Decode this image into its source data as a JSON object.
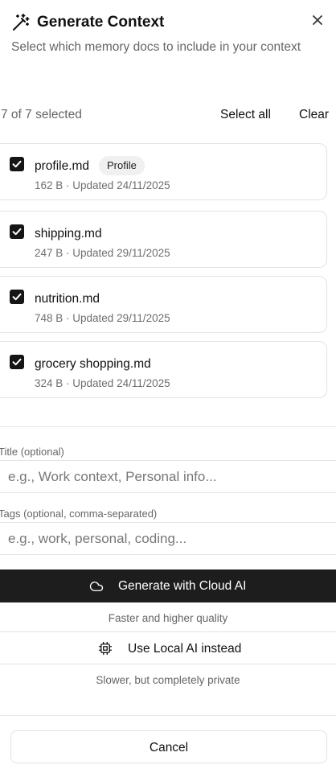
{
  "header": {
    "title": "Generate Context",
    "subtitle": "Select which memory docs to include in your context"
  },
  "selection": {
    "count_text": "7 of 7 selected",
    "select_all_label": "Select all",
    "clear_label": "Clear"
  },
  "docs": [
    {
      "name": "profile.md",
      "badge": "Profile",
      "meta": "162 B · Updated 24/11/2025",
      "checked": true
    },
    {
      "name": "shipping.md",
      "meta": "247 B · Updated 29/11/2025",
      "checked": true
    },
    {
      "name": "nutrition.md",
      "meta": "748 B · Updated 29/11/2025",
      "checked": true
    },
    {
      "name": "grocery shopping.md",
      "meta": "324 B · Updated 24/11/2025",
      "checked": true
    }
  ],
  "form": {
    "title_label": "Title (optional)",
    "title_value": "",
    "title_placeholder": "e.g., Work context, Personal info...",
    "tags_label": "Tags (optional, comma-separated)",
    "tags_value": "",
    "tags_placeholder": "e.g., work, personal, coding..."
  },
  "actions": {
    "cloud_label": "Generate with Cloud AI",
    "cloud_hint": "Faster and higher quality",
    "local_label": "Use Local AI instead",
    "local_hint": "Slower, but completely private",
    "cancel_label": "Cancel"
  },
  "icons": {
    "header": "magic-wand-icon",
    "close": "close-icon",
    "checkbox": "checkbox-checked-icon",
    "cloud": "cloud-icon",
    "local": "cpu-chip-icon"
  },
  "colors": {
    "primary_button": "#1d1d1d",
    "checkbox": "#151515",
    "muted_text": "#666666",
    "border": "#e3e3e3",
    "badge_bg": "#f0f0f0"
  }
}
